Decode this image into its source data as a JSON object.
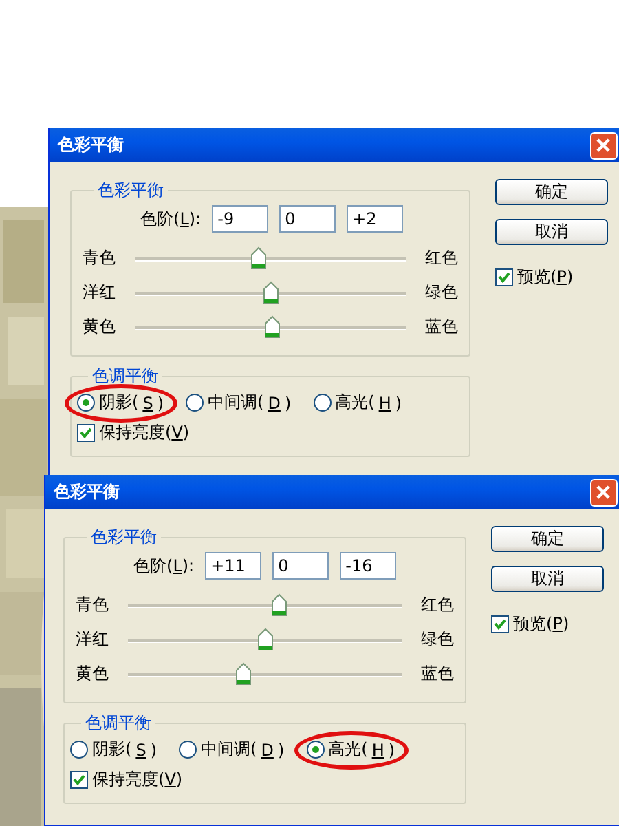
{
  "dialogs": [
    {
      "title": "色彩平衡",
      "color_group": {
        "title": "色彩平衡",
        "levels_label": "色阶(L):",
        "levels": [
          "-9",
          "0",
          "+2"
        ],
        "sliders": [
          {
            "left": "青色",
            "right": "红色",
            "level": 0.455
          },
          {
            "left": "洋红",
            "right": "绿色",
            "level": 0.5
          },
          {
            "left": "黄色",
            "right": "蓝色",
            "level": 0.51
          }
        ]
      },
      "tone_group": {
        "title": "色调平衡",
        "options": [
          {
            "label": "阴影(S)",
            "selected": true,
            "circled": true
          },
          {
            "label": "中间调(D)",
            "selected": false,
            "circled": false
          },
          {
            "label": "高光(H)",
            "selected": false,
            "circled": false
          }
        ],
        "preserve": {
          "label": "保持亮度(V)",
          "checked": true
        }
      },
      "buttons": [
        "确定",
        "取消"
      ],
      "preview": {
        "label": "预览(P)",
        "checked": true
      }
    },
    {
      "title": "色彩平衡",
      "color_group": {
        "title": "色彩平衡",
        "levels_label": "色阶(L):",
        "levels": [
          "+11",
          "0",
          "-16"
        ],
        "sliders": [
          {
            "left": "青色",
            "right": "红色",
            "level": 0.555
          },
          {
            "left": "洋红",
            "right": "绿色",
            "level": 0.5
          },
          {
            "left": "黄色",
            "right": "蓝色",
            "level": 0.42
          }
        ]
      },
      "tone_group": {
        "title": "色调平衡",
        "options": [
          {
            "label": "阴影(S)",
            "selected": false,
            "circled": false
          },
          {
            "label": "中间调(D)",
            "selected": false,
            "circled": false
          },
          {
            "label": "高光(H)",
            "selected": true,
            "circled": true
          }
        ],
        "preserve": {
          "label": "保持亮度(V)",
          "checked": true
        }
      },
      "buttons": [
        "确定",
        "取消"
      ],
      "preview": {
        "label": "预览(P)",
        "checked": true
      }
    }
  ]
}
